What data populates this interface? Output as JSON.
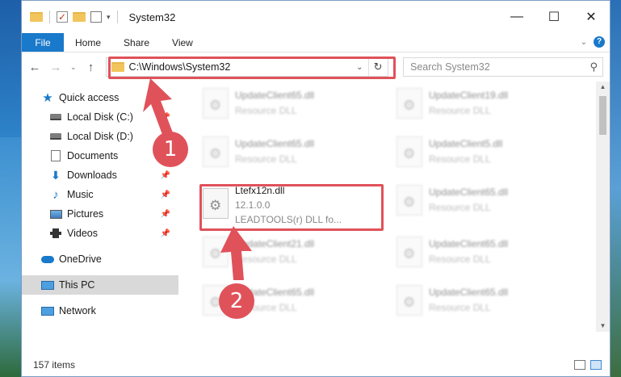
{
  "window": {
    "title": "System32",
    "controls": {
      "minimize": "—",
      "maximize": "☐",
      "close": "✕"
    }
  },
  "ribbon": {
    "tabs": [
      {
        "label": "File"
      },
      {
        "label": "Home"
      },
      {
        "label": "Share"
      },
      {
        "label": "View"
      }
    ]
  },
  "navigation": {
    "back": "←",
    "forward": "→",
    "recent": "⌄",
    "up": "↑",
    "address": "C:\\Windows\\System32",
    "search_placeholder": "Search System32"
  },
  "sidebar": {
    "items": [
      {
        "label": "Quick access",
        "icon": "star-icon",
        "pinned": false,
        "selected": false
      },
      {
        "label": "Local Disk (C:)",
        "icon": "drive-icon",
        "pinned": true,
        "selected": false
      },
      {
        "label": "Local Disk (D:)",
        "icon": "drive-icon",
        "pinned": false,
        "selected": false
      },
      {
        "label": "Documents",
        "icon": "documents-icon",
        "pinned": true,
        "selected": false
      },
      {
        "label": "Downloads",
        "icon": "download-icon",
        "pinned": true,
        "selected": false
      },
      {
        "label": "Music",
        "icon": "music-icon",
        "pinned": true,
        "selected": false
      },
      {
        "label": "Pictures",
        "icon": "pictures-icon",
        "pinned": true,
        "selected": false
      },
      {
        "label": "Videos",
        "icon": "videos-icon",
        "pinned": true,
        "selected": false
      },
      {
        "label": "OneDrive",
        "icon": "cloud-icon",
        "pinned": false,
        "selected": false
      },
      {
        "label": "This PC",
        "icon": "computer-icon",
        "pinned": false,
        "selected": true
      },
      {
        "label": "Network",
        "icon": "network-icon",
        "pinned": false,
        "selected": false
      }
    ]
  },
  "files": [
    {
      "name": "UpdateClient65.dll",
      "detail": "Resource DLL",
      "blurred": true
    },
    {
      "name": "UpdateClient19.dll",
      "detail": "Resource DLL",
      "blurred": true
    },
    {
      "name": "UpdateClient65.dll",
      "detail": "Resource DLL",
      "blurred": true
    },
    {
      "name": "UpdateClient5.dll",
      "detail": "Resource DLL",
      "blurred": true
    },
    {
      "name": "Ltefx12n.dll",
      "version": "12.1.0.0",
      "detail": "LEADTOOLS(r) DLL fo...",
      "blurred": false
    },
    {
      "name": "UpdateClient65.dll",
      "detail": "Resource DLL",
      "blurred": true
    },
    {
      "name": "UpdateClient21.dll",
      "detail": "Resource DLL",
      "blurred": true
    },
    {
      "name": "UpdateClient65.dll",
      "detail": "Resource DLL",
      "blurred": true
    },
    {
      "name": "UpdateClient65.dll",
      "detail": "Resource DLL",
      "blurred": true
    },
    {
      "name": "UpdateClient65.dll",
      "detail": "Resource DLL",
      "blurred": true
    }
  ],
  "status": {
    "item_count": "157 items"
  },
  "annotations": [
    {
      "number": "1"
    },
    {
      "number": "2"
    }
  ],
  "colors": {
    "accent": "#1979ca",
    "highlight": "#e0525a"
  }
}
